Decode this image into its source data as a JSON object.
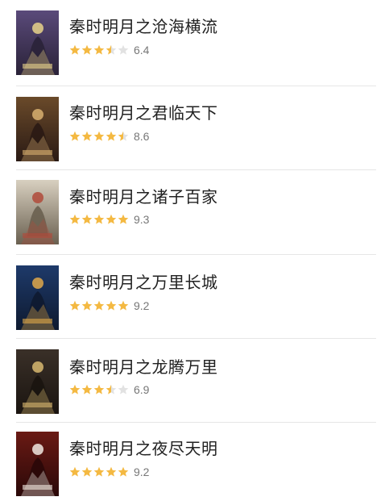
{
  "colors": {
    "star_filled": "#f4b942",
    "star_empty": "#e2e2e2",
    "title": "#222222",
    "score": "#777777",
    "divider": "#e6e6e6"
  },
  "items": [
    {
      "title": "秦时明月之沧海横流",
      "score": "6.4",
      "rating": 3.5,
      "cover": {
        "bg": "#5a4a7a",
        "accent": "#e8d28a",
        "dark": "#2a2238"
      }
    },
    {
      "title": "秦时明月之君临天下",
      "score": "8.6",
      "rating": 4.5,
      "cover": {
        "bg": "#6a4a2a",
        "accent": "#d8b070",
        "dark": "#2a1a14"
      }
    },
    {
      "title": "秦时明月之诸子百家",
      "score": "9.3",
      "rating": 5,
      "cover": {
        "bg": "#d8d0c0",
        "accent": "#b04a3a",
        "dark": "#6a6050"
      }
    },
    {
      "title": "秦时明月之万里长城",
      "score": "9.2",
      "rating": 5,
      "cover": {
        "bg": "#1e3a6a",
        "accent": "#e0a84a",
        "dark": "#0e1a30"
      }
    },
    {
      "title": "秦时明月之龙腾万里",
      "score": "6.9",
      "rating": 3.5,
      "cover": {
        "bg": "#3a3028",
        "accent": "#d8b870",
        "dark": "#1a1410"
      }
    },
    {
      "title": "秦时明月之夜尽天明",
      "score": "9.2",
      "rating": 5,
      "cover": {
        "bg": "#6a1a14",
        "accent": "#f0e8e0",
        "dark": "#2a0808"
      }
    }
  ]
}
